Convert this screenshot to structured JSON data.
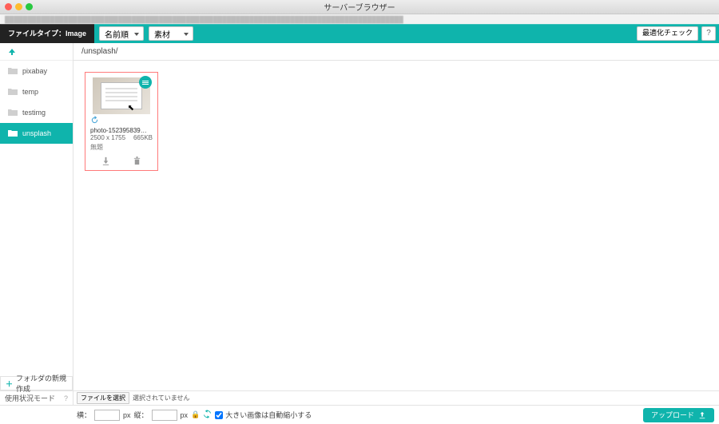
{
  "window": {
    "title": "サーバーブラウザー"
  },
  "toolbar": {
    "filetype_label": "ファイルタイプ：Image",
    "sort_select": "名前順",
    "material_select": "素材",
    "optimize_check": "最適化チェック",
    "help_label": "?"
  },
  "sidebar": {
    "folders": [
      {
        "name": "pixabay",
        "active": false
      },
      {
        "name": "temp",
        "active": false
      },
      {
        "name": "testimg",
        "active": false
      },
      {
        "name": "unsplash",
        "active": true
      }
    ],
    "new_folder_label": "フォルダの新規作成"
  },
  "breadcrumb": "/unsplash/",
  "file": {
    "name": "photo-152395839…",
    "dimensions": "2500 x 1755",
    "size": "665KB",
    "kind": "無題"
  },
  "footer": {
    "mode_label": "使用状況モード",
    "mode_help": "?",
    "file_select_btn": "ファイルを選択",
    "no_file_selected": "選択されていません",
    "width_label": "横：",
    "height_label": "縦：",
    "px_label": "px",
    "shrink_label": "大きい画像は自動縮小する",
    "upload_label": "アップロード"
  }
}
